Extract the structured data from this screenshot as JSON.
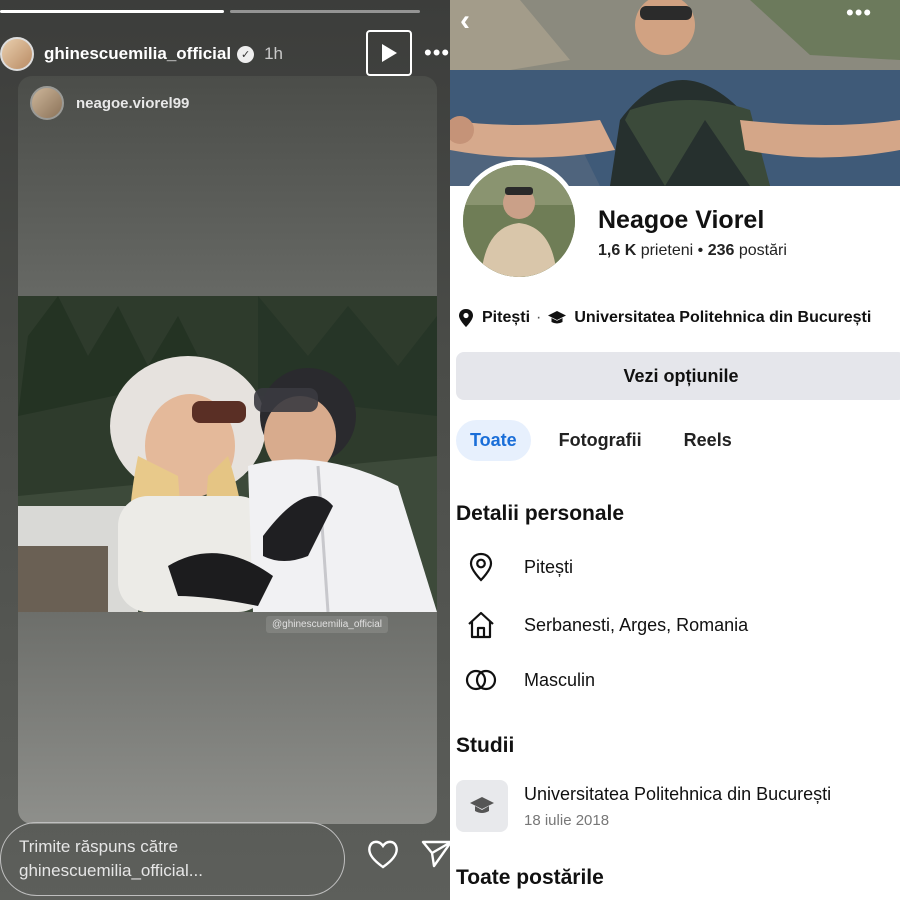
{
  "story": {
    "username": "ghinescuemilia_official",
    "time": "1h",
    "reply_placeholder_line1": "Trimite răspuns către",
    "reply_placeholder_line2": "ghinescuemilia_official...",
    "shared_post": {
      "username": "neagoe.viorel99",
      "credit": "@ghinescuemilia_official"
    },
    "progress": [
      1.0,
      0.35
    ]
  },
  "profile": {
    "name": "Neagoe Viorel",
    "friends_count": "1,6 K",
    "friends_label": "prieteni",
    "posts_count": "236",
    "posts_label": "postări",
    "location": "Pitești",
    "school": "Universitatea Politehnica din București",
    "options_button": "Vezi opțiunile",
    "tabs": [
      "Toate",
      "Fotografii",
      "Reels"
    ],
    "section_personal": "Detalii personale",
    "details": [
      {
        "icon": "location-pin-icon",
        "text": "Pitești"
      },
      {
        "icon": "home-icon",
        "text": "Serbanesti, Arges, Romania"
      },
      {
        "icon": "gender-icon",
        "text": "Masculin"
      }
    ],
    "section_studies": "Studii",
    "study": {
      "school": "Universitatea Politehnica din București",
      "date": "18 iulie 2018"
    },
    "section_posts": "Toate postările"
  },
  "colors": {
    "accent": "#1a6ed8",
    "tab_active_bg": "#e7f0fd",
    "button_bg": "#e5e6eb"
  }
}
